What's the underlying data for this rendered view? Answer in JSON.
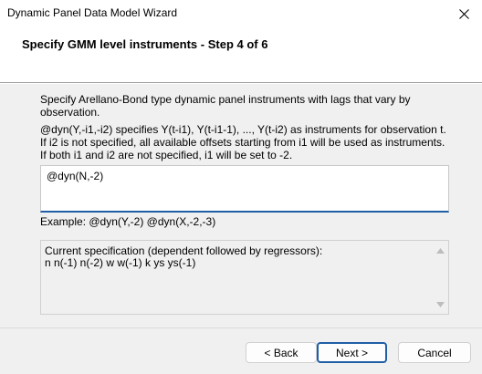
{
  "window": {
    "title": "Dynamic Panel Data Model Wizard",
    "close_icon": "close-icon"
  },
  "header": {
    "step_title": "Specify GMM level instruments - Step 4 of 6"
  },
  "main": {
    "description": "Specify Arellano-Bond type dynamic panel instruments with lags that vary by observation.",
    "help_text": "@dyn(Y,-i1,-i2) specifies Y(t-i1), Y(t-i1-1), ..., Y(t-i2) as instruments for observation t. If i2 is not specified, all available offsets starting from i1 will be used as instruments. If both i1 and i2 are not specified, i1 will be set to -2.",
    "instrument_input": {
      "value": "@dyn(N,-2)"
    },
    "example": "Example: @dyn(Y,-2)   @dyn(X,-2,-3)",
    "spec": {
      "label": "Current specification (dependent followed by regressors):",
      "value": "n n(-1) n(-2) w w(-1) k ys ys(-1)"
    }
  },
  "footer": {
    "back_label": "< Back",
    "next_label": "Next >",
    "cancel_label": "Cancel"
  },
  "colors": {
    "accent": "#1f5fa8",
    "panel_bg": "#f0f0f0"
  }
}
